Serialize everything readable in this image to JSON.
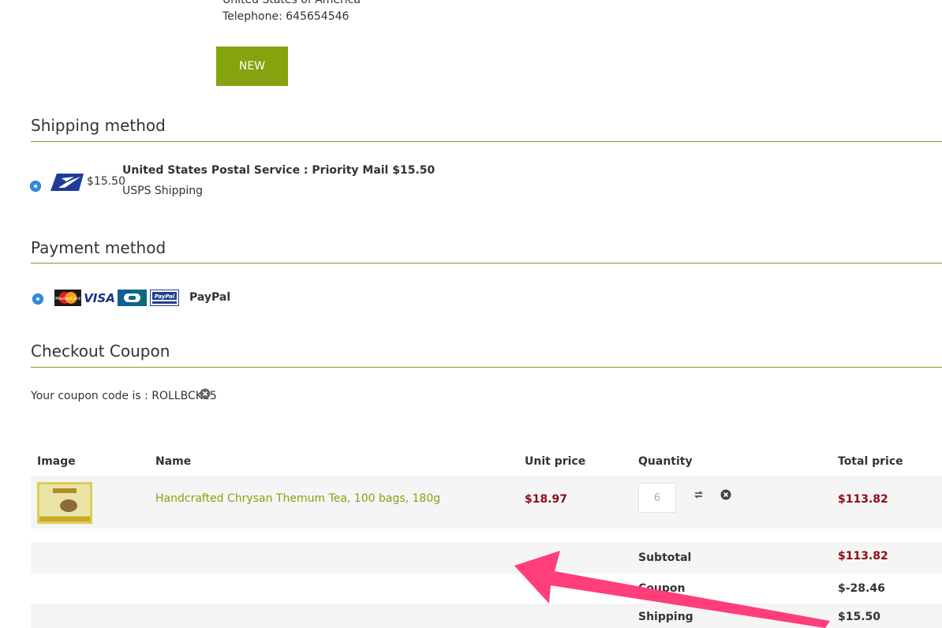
{
  "address": {
    "country": "United States of America",
    "telephone": "Telephone: 645654546",
    "new_button": "NEW"
  },
  "shipping": {
    "title": "Shipping method",
    "price_short": "$15.50",
    "service": "United States Postal Service : Priority Mail $15.50",
    "sub": "USPS Shipping"
  },
  "payment": {
    "title": "Payment method",
    "label": "PayPal",
    "card_logos": [
      "mastercard-icon",
      "visa-icon",
      "cb-icon",
      "paypal-icon"
    ],
    "visa_text": "VISA",
    "mastercard_text": "MasterCard",
    "paypal_text": "PayPal"
  },
  "coupon": {
    "title": "Checkout Coupon",
    "text": "Your coupon code is : ROLLBCK15"
  },
  "cart": {
    "headers": [
      "Image",
      "Name",
      "Unit price",
      "Quantity",
      "Total price"
    ],
    "item": {
      "name": "Handcrafted Chrysan Themum Tea, 100 bags, 180g",
      "unit_price": "$18.97",
      "quantity": "6",
      "total": "$113.82"
    },
    "summary": {
      "subtotal_label": "Subtotal",
      "subtotal": "$113.82",
      "coupon_label": "Coupon",
      "coupon": "$-28.46",
      "shipping_label": "Shipping",
      "shipping": "$15.50"
    }
  },
  "colors": {
    "accent": "#85a20f",
    "price": "#8c0e14",
    "annotation_arrow": "#ff3e7a"
  }
}
